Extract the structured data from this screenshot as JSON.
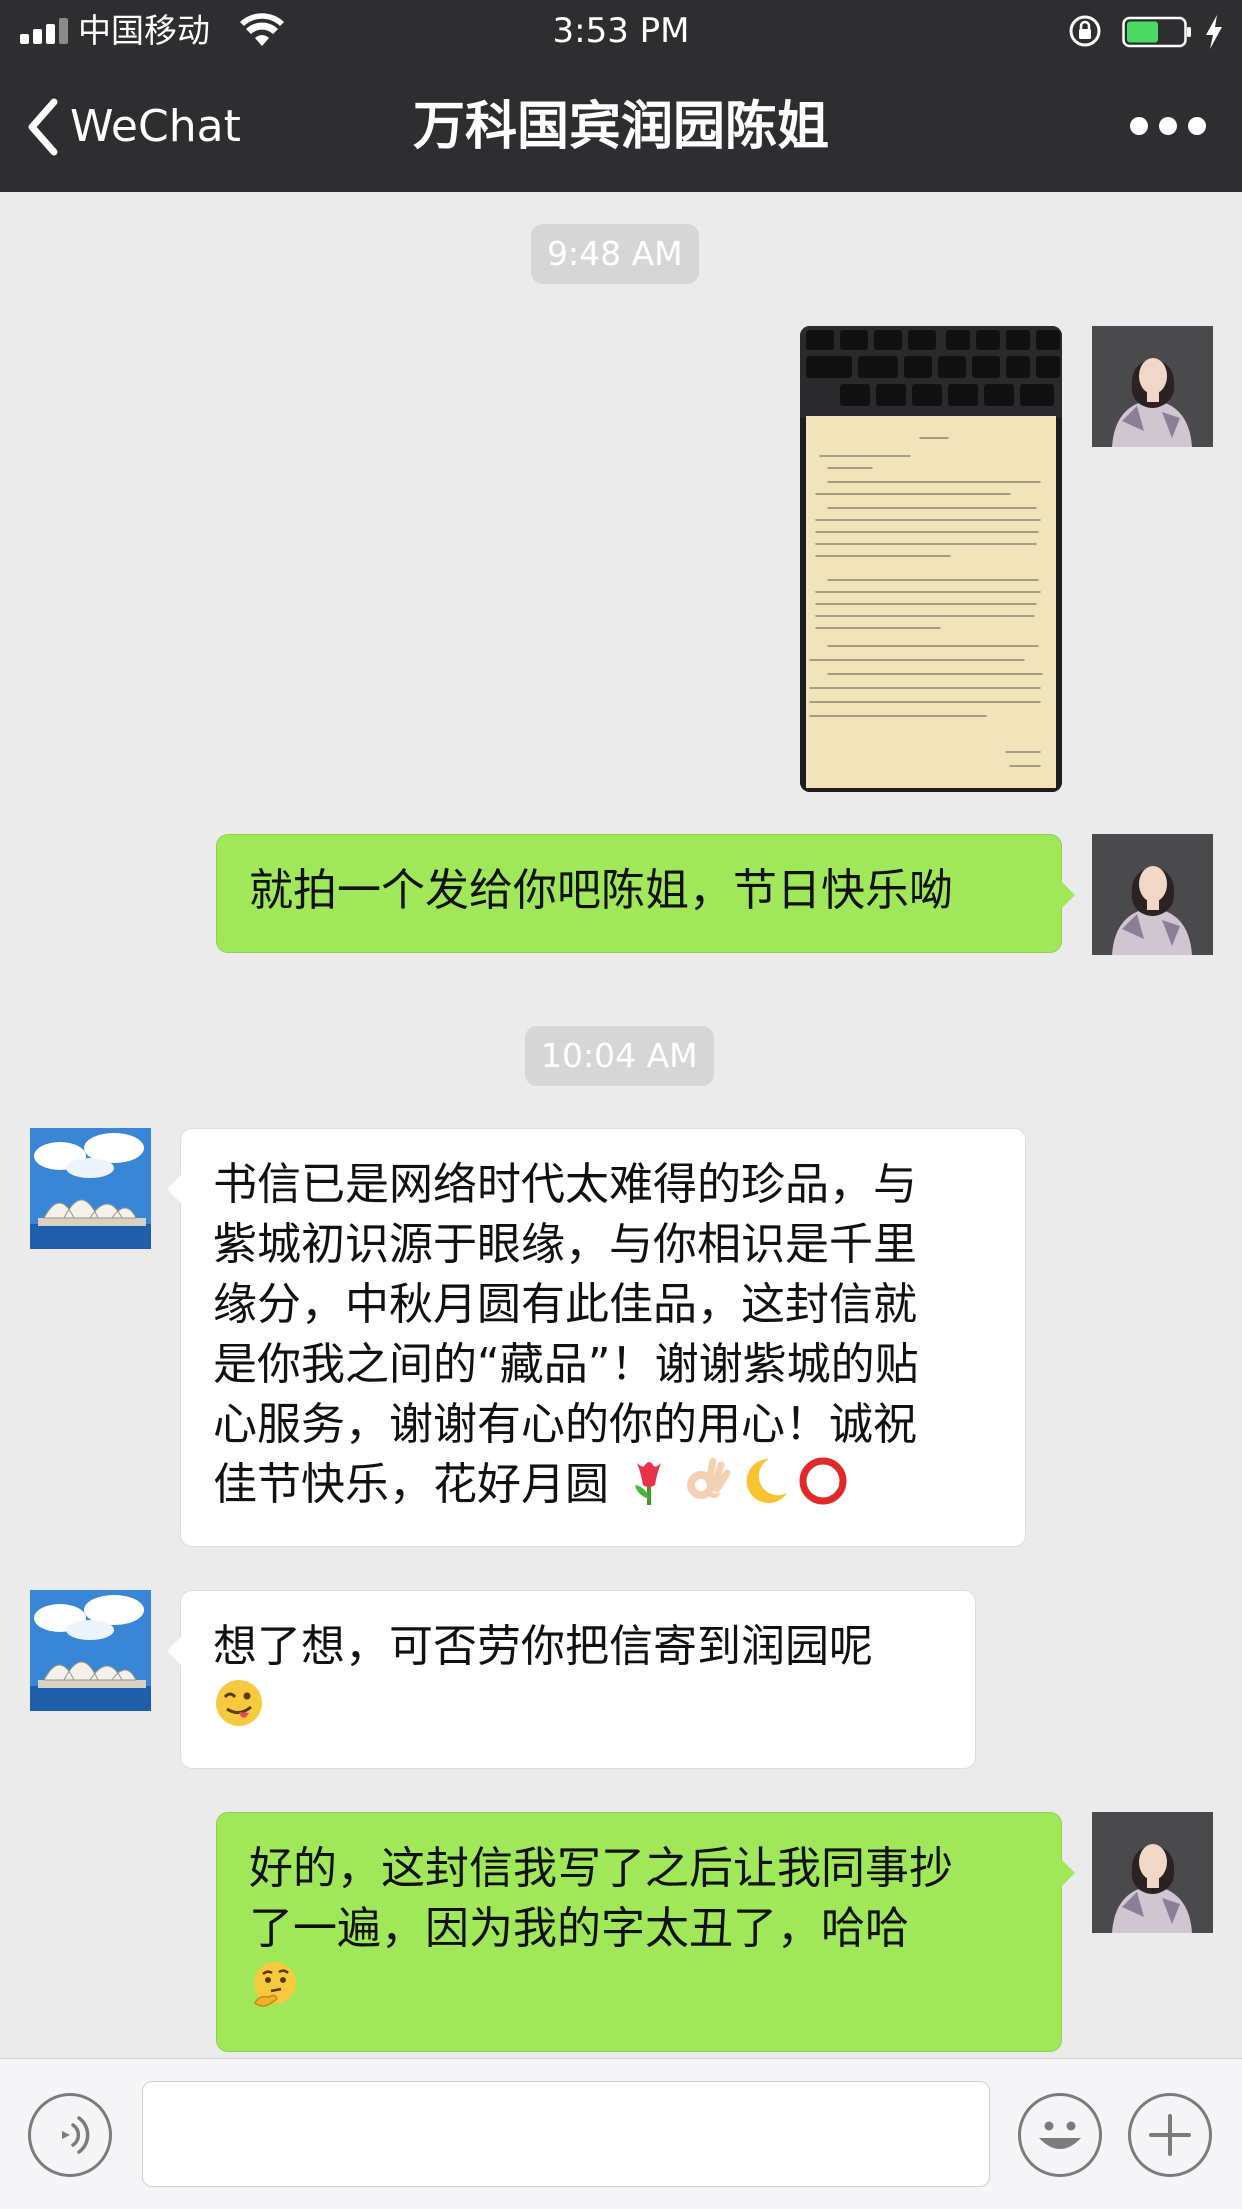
{
  "status_bar": {
    "carrier": "中国移动",
    "time": "3:53 PM",
    "signal_bars": 3,
    "battery_level": 0.55,
    "battery_color": "#4cd964",
    "icons": [
      "signal-icon",
      "wifi-icon",
      "orientation-lock-icon",
      "battery-icon",
      "charging-bolt-icon"
    ]
  },
  "nav": {
    "back_label": "WeChat",
    "title": "万科国宾润园陈姐",
    "more_icon": "more-dots-icon"
  },
  "chat": {
    "timestamps": [
      "9:48 AM",
      "10:04 AM"
    ],
    "messages": [
      {
        "from": "me",
        "type": "image",
        "content": "handwritten-letter-photo"
      },
      {
        "from": "me",
        "type": "text",
        "text": "就拍一个发给你吧陈姐，节日快乐呦"
      },
      {
        "from": "them",
        "type": "text",
        "lines": [
          "书信已是网络时代太难得的珍品，与",
          "紫城初识源于眼缘，与你相识是千里",
          "缘分，中秋月圆有此佳品，这封信就",
          "是你我之间的“藏品”！谢谢紫城的贴",
          "心服务，谢谢有心的你的用心！诚祝",
          "佳节快乐，花好月圆"
        ],
        "emojis": [
          "tulip-emoji",
          "ok-hand-emoji",
          "crescent-moon-emoji",
          "red-circle-emoji"
        ]
      },
      {
        "from": "them",
        "type": "text",
        "lines": [
          "想了想，可否劳你把信寄到润园呢"
        ],
        "emojis": [
          "winking-tongue-emoji"
        ]
      },
      {
        "from": "me",
        "type": "text",
        "lines": [
          "好的，这封信我写了之后让我同事抄",
          "了一遍，因为我的字太丑了，哈哈"
        ],
        "emojis": [
          "thinking-face-emoji"
        ]
      }
    ]
  },
  "input_bar": {
    "value": "",
    "voice_icon": "voice-icon",
    "emoji_icon": "emoji-face-icon",
    "add_icon": "plus-icon"
  },
  "colors": {
    "nav_background": "#2e2e30",
    "chat_background": "#ebebeb",
    "outgoing_bubble": "#a0e75a",
    "incoming_bubble": "#ffffff",
    "timestamp_pill": "#d6d6d6"
  }
}
